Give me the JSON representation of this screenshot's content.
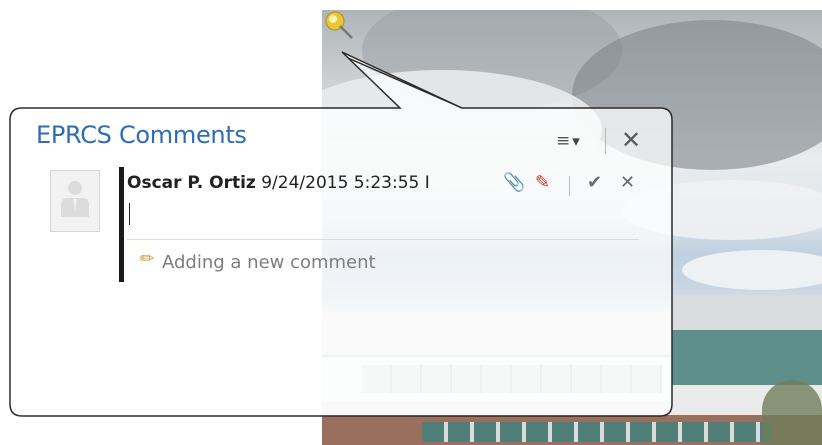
{
  "comments_panel": {
    "title": "EPRCS Comments",
    "menu_glyph": "≡",
    "dropdown_glyph": "▾",
    "close_glyph": "✕"
  },
  "comment": {
    "author": "Oscar P. Ortiz",
    "timestamp": "9/24/2015 5:23:55 I",
    "attach_glyph": "📎",
    "format_glyph": "✎",
    "accept_glyph": "✔",
    "cancel_glyph": "✕",
    "status_text": "Adding a new comment"
  },
  "colors": {
    "title": "#2e6db3",
    "pin": "#e8c53a"
  },
  "icons": [
    "pushpin-icon",
    "menu-icon",
    "dropdown-icon",
    "close-icon",
    "avatar-icon",
    "paperclip-icon",
    "highlighter-icon",
    "checkmark-icon",
    "cancel-icon",
    "pencil-icon"
  ]
}
